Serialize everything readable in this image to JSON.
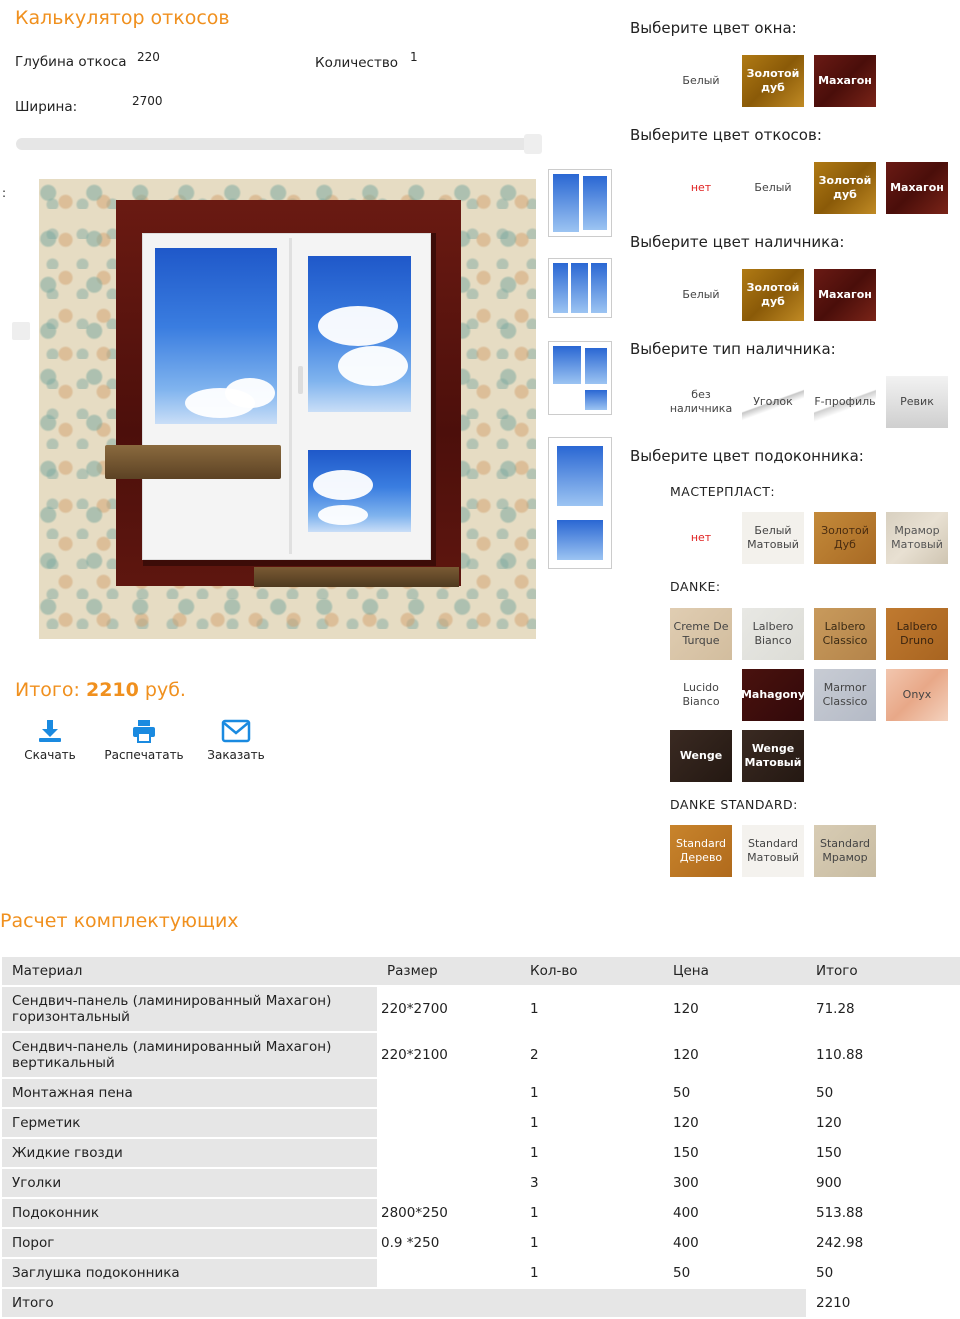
{
  "calculator": {
    "title": "Калькулятор откосов",
    "depth_label": "Глубина откоса",
    "depth_value": "220",
    "qty_label": "Количество",
    "qty_value": "1",
    "width_label": "Ширина:",
    "width_value": "2700",
    "colon": ":"
  },
  "total": {
    "label": "Итого:",
    "value": "2210",
    "currency": "руб."
  },
  "actions": [
    {
      "label": "Скачать",
      "icon": "download-icon"
    },
    {
      "label": "Распечатать",
      "icon": "print-icon"
    },
    {
      "label": "Заказать",
      "icon": "mail-icon"
    }
  ],
  "options": {
    "window_color": {
      "title": "Выберите цвет окна:",
      "items": [
        "Белый",
        "Золотой дуб",
        "Махагон"
      ]
    },
    "slope_color": {
      "title": "Выберите цвет откосов:",
      "items": [
        "нет",
        "Белый",
        "Золотой дуб",
        "Махагон"
      ]
    },
    "trim_color": {
      "title": "Выберите цвет наличника:",
      "items": [
        "Белый",
        "Золотой дуб",
        "Махагон"
      ]
    },
    "trim_type": {
      "title": "Выберите тип наличника:",
      "items": [
        "без наличника",
        "Уголок",
        "F-профиль",
        "Ревик"
      ]
    },
    "sill_color": {
      "title": "Выберите цвет подоконника:",
      "masterplast": {
        "label": "МАСТЕРПЛАСТ:",
        "items": [
          "нет",
          "Белый Матовый",
          "Золотой Дуб",
          "Мрамор Матовый"
        ]
      },
      "danke": {
        "label": "DANKE:",
        "items": [
          "Creme De Turque",
          "Lalbero Bianco",
          "Lalbero Classico",
          "Lalbero Druno",
          "Lucido Bianco",
          "Mahagony",
          "Marmor Classico",
          "Onyx",
          "Wenge",
          "Wenge Матовый"
        ]
      },
      "danke_standard": {
        "label": "DANKE STANDARD:",
        "items": [
          "Standard Дерево",
          "Standard Матовый",
          "Standard Мрамор"
        ]
      }
    }
  },
  "components": {
    "title": "Расчет комплектующих",
    "headers": [
      "Материал",
      "Размер",
      "Кол-во",
      "Цена",
      "Итого"
    ],
    "rows": [
      [
        "Сендвич-панель (ламинированный Махагон) горизонтальный",
        "220*2700",
        "1",
        "120",
        "71.28"
      ],
      [
        "Сендвич-панель (ламинированный Махагон) вертикальный",
        "220*2100",
        "2",
        "120",
        "110.88"
      ],
      [
        "Монтажная пена",
        "",
        "1",
        "50",
        "50"
      ],
      [
        "Герметик",
        "",
        "1",
        "120",
        "120"
      ],
      [
        "Жидкие гвозди",
        "",
        "1",
        "150",
        "150"
      ],
      [
        "Уголки",
        "",
        "3",
        "300",
        "900"
      ],
      [
        "Подоконник",
        "2800*250",
        "1",
        "400",
        "513.88"
      ],
      [
        "Порог",
        "0.9 *250",
        "1",
        "400",
        "242.98"
      ],
      [
        "Заглушка подоконника",
        "",
        "1",
        "50",
        "50"
      ],
      [
        "Итого",
        "",
        "",
        "",
        "2210"
      ]
    ]
  }
}
